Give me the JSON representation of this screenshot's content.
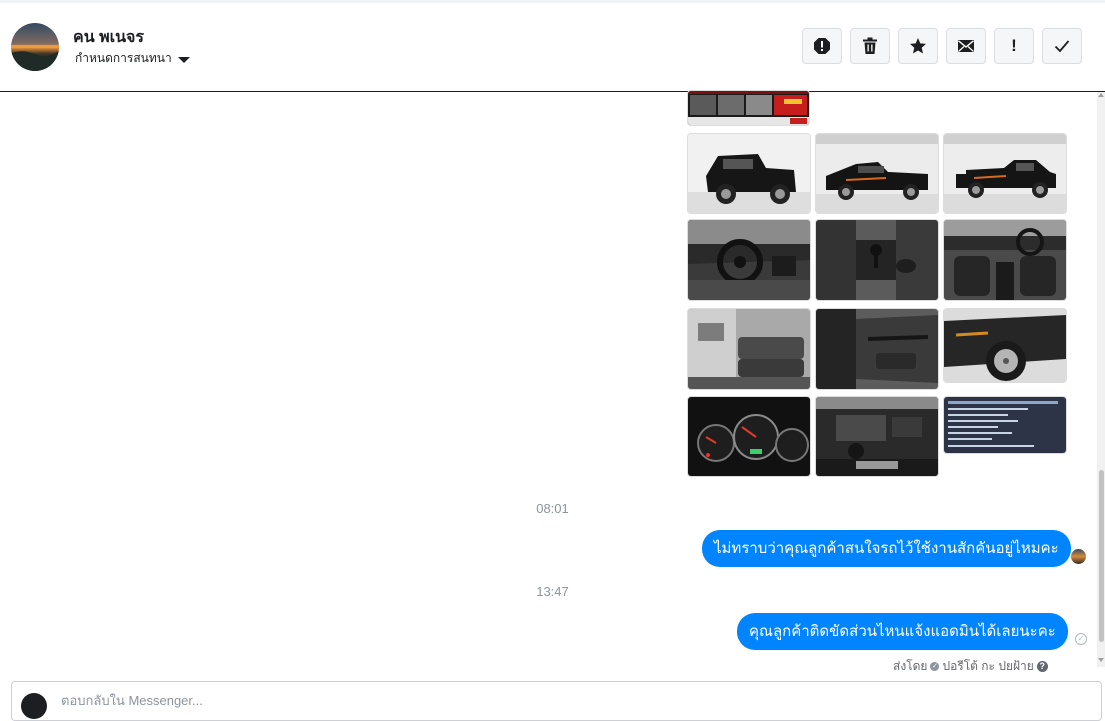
{
  "header": {
    "contact_name": "คน พเนจร",
    "conversation_settings": "กำหนดการสนทนา",
    "actions": [
      {
        "name": "mark-spam",
        "icon": "report-icon"
      },
      {
        "name": "delete",
        "icon": "trash-icon"
      },
      {
        "name": "star",
        "icon": "star-icon"
      },
      {
        "name": "mark-unread",
        "icon": "envelope-icon"
      },
      {
        "name": "follow-up",
        "icon": "exclamation-icon",
        "label": "!"
      },
      {
        "name": "mark-done",
        "icon": "checkmark-icon"
      }
    ]
  },
  "attachments": {
    "photos": [
      {
        "subject": "listing-banner"
      },
      {
        "subject": "truck-rear-quarter"
      },
      {
        "subject": "truck-side"
      },
      {
        "subject": "truck-side-angle"
      },
      {
        "subject": "dashboard-steering"
      },
      {
        "subject": "gear-shifter-console"
      },
      {
        "subject": "front-cabin"
      },
      {
        "subject": "rear-seat"
      },
      {
        "subject": "door-panel"
      },
      {
        "subject": "wheel-closeup"
      },
      {
        "subject": "instrument-cluster"
      },
      {
        "subject": "engine-bay"
      },
      {
        "subject": "spec-sheet"
      }
    ]
  },
  "messages": [
    {
      "time": "08:01",
      "text": "ไม่ทราบว่าคุณลูกค้าสนใจรถไว้ใช้งานสักคันอยู่ไหมคะ",
      "status": "seen"
    },
    {
      "time": "13:47",
      "text": "คุณลูกค้าติดขัดส่วนไหนแจ้งแอดมินได้เลยนะคะ",
      "status": "sent"
    }
  ],
  "sent_by": {
    "prefix": "ส่งโดย",
    "name": "ปอรีโต้ กะ ปยฝ้าย",
    "help": "?"
  },
  "composer": {
    "placeholder": "ตอบกลับใน Messenger..."
  },
  "colors": {
    "bubble": "#0084ff",
    "header_border": "#1c1e21",
    "timestamp": "#8d949e"
  }
}
